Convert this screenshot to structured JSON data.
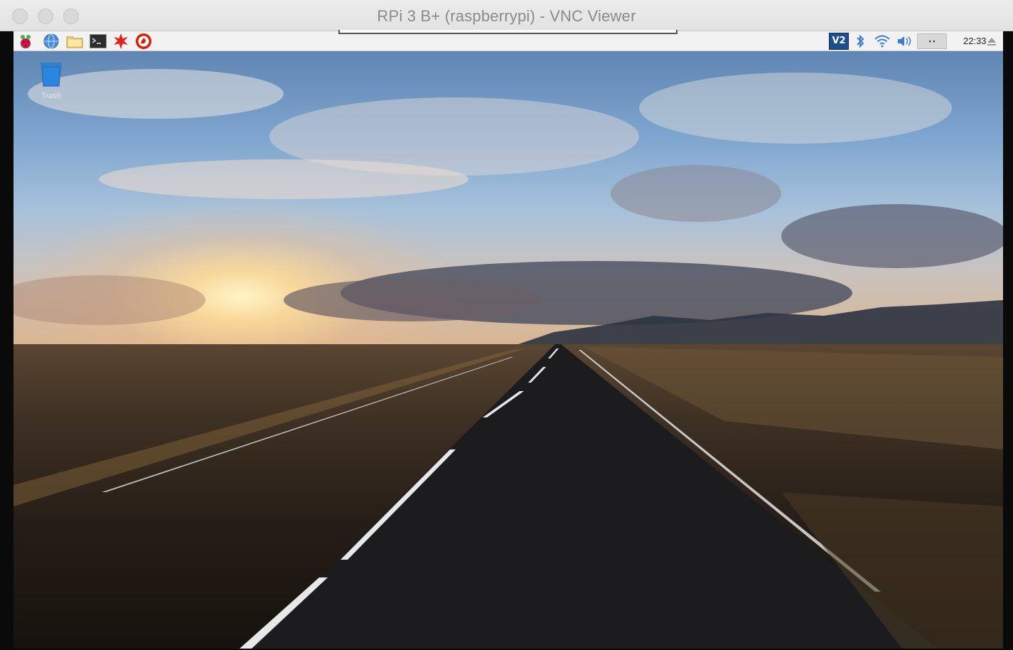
{
  "window": {
    "title": "RPi 3 B+ (raspberrypi) - VNC Viewer"
  },
  "taskbar": {
    "launchers": [
      {
        "icon": "raspberry-menu-icon"
      },
      {
        "icon": "web-browser-icon"
      },
      {
        "icon": "file-manager-icon"
      },
      {
        "icon": "terminal-icon"
      },
      {
        "icon": "mathematica-icon"
      },
      {
        "icon": "wolfram-icon"
      }
    ],
    "tray": {
      "vnc_label": "V2",
      "clock": "22:33"
    }
  },
  "desktop": {
    "trash_label": "Trash"
  },
  "colors": {
    "panel_bg": "#f2f2f2",
    "vnc_blue": "#1e4e8c",
    "accent_blue": "#3a7bd5"
  }
}
